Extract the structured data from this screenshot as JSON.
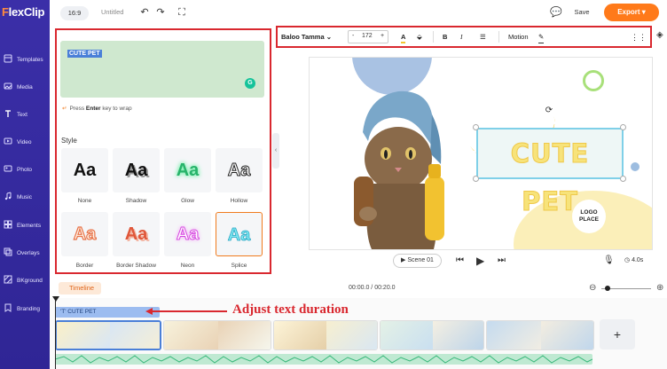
{
  "app": {
    "logo_prefix": "F",
    "logo_rest": "lexClip"
  },
  "sidebar": {
    "items": [
      {
        "label": "Templates",
        "icon": "templates-icon"
      },
      {
        "label": "Media",
        "icon": "media-icon"
      },
      {
        "label": "Text",
        "icon": "text-icon"
      },
      {
        "label": "Video",
        "icon": "video-icon"
      },
      {
        "label": "Photo",
        "icon": "photo-icon"
      },
      {
        "label": "Music",
        "icon": "music-icon"
      },
      {
        "label": "Elements",
        "icon": "elements-icon"
      },
      {
        "label": "Overlays",
        "icon": "overlays-icon"
      },
      {
        "label": "BKground",
        "icon": "background-icon"
      },
      {
        "label": "Branding",
        "icon": "branding-icon"
      }
    ]
  },
  "topbar": {
    "ratio": "16:9",
    "project_title": "Untitled",
    "save_label": "Save",
    "export_label": "Export"
  },
  "text_panel": {
    "preview_text": "CUTE PET",
    "hint_prefix": "Press",
    "hint_key": "Enter",
    "hint_suffix": "key to wrap",
    "style_heading": "Style",
    "styles": [
      {
        "name": "None",
        "sample": "Aa"
      },
      {
        "name": "Shadow",
        "sample": "Aa"
      },
      {
        "name": "Glow",
        "sample": "Aa"
      },
      {
        "name": "Hollow",
        "sample": "Aa"
      },
      {
        "name": "Border",
        "sample": "Aa"
      },
      {
        "name": "Border Shadow",
        "sample": "Aa"
      },
      {
        "name": "Neon",
        "sample": "Aa"
      },
      {
        "name": "Splice",
        "sample": "Aa"
      }
    ],
    "selected_style": "Splice"
  },
  "text_toolbar": {
    "font_family": "Baloo Tamma",
    "font_size": "172",
    "decrease": "-",
    "increase": "+",
    "motion_label": "Motion"
  },
  "canvas": {
    "title_text": "CUTE PET",
    "logo_line1": "LOGO",
    "logo_line2": "PLACE"
  },
  "player": {
    "scene_label": "Scene 01",
    "duration": "4.0s"
  },
  "timeline": {
    "label": "Timeline",
    "time": "00:00.0 / 00:20.0",
    "text_track_label": "CUTE PET",
    "add_label": "+"
  },
  "annotation": {
    "text": "Adjust text duration"
  },
  "colors": {
    "sidebar": "#3b2fa8",
    "accent": "#ff7a1a",
    "highlight_border": "#d9282f",
    "title_fill": "#f7e37a"
  }
}
